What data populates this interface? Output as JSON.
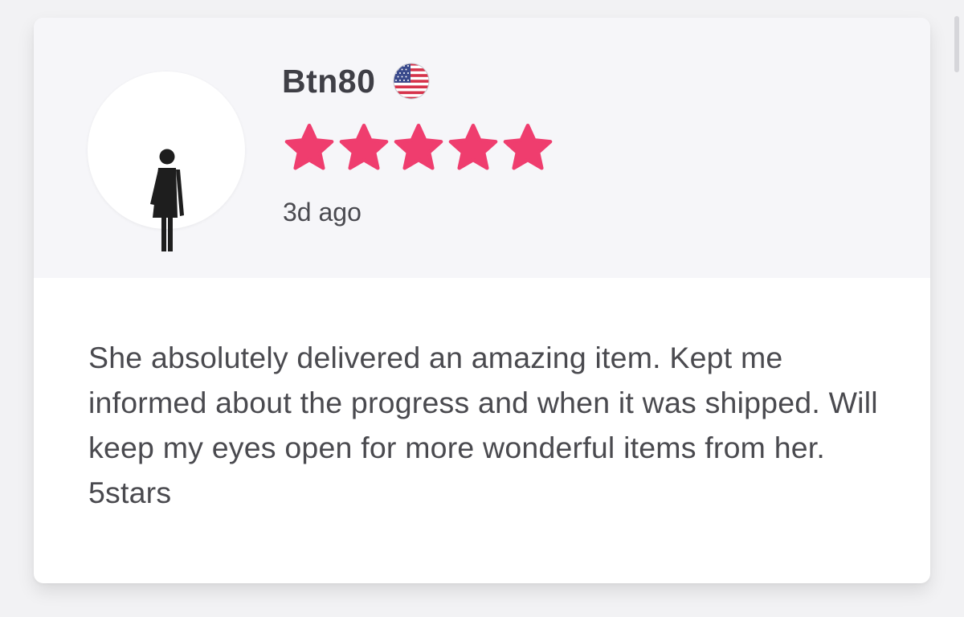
{
  "review": {
    "username": "Btn80",
    "country_flag_icon": "us-flag-icon",
    "rating": {
      "value": 5,
      "max": 5,
      "star_color": "#ef3d6e"
    },
    "time_ago": "3d ago",
    "body": "She absolutely delivered an amazing item. Kept me informed about the progress and when it was shipped. Will keep my eyes open for more wonderful items from her. 5stars"
  },
  "avatar": {
    "icon": "female-figure-icon"
  },
  "colors": {
    "header_background": "#f6f6f9",
    "card_background": "#ffffff",
    "text_primary": "#3f3f46"
  }
}
